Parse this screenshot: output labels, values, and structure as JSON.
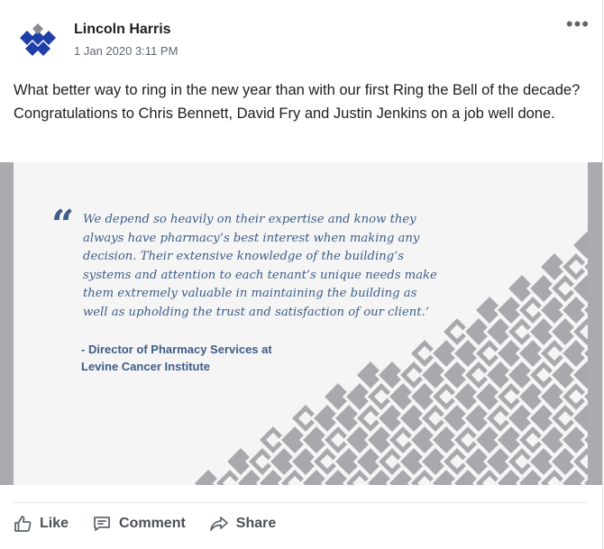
{
  "post": {
    "author": "Lincoln Harris",
    "timestamp": "1 Jan 2020 3:11 PM",
    "more_label": "•••",
    "text": "What better way to ring in the new year than with our first Ring the Bell of the decade? Congratulations to Chris Bennett, David Fry and Justin Jenkins on a job well done."
  },
  "image": {
    "quote_mark": "“",
    "quote": "We depend so heavily on their expertise and know they always have pharmacy’s best interest when making any decision. Their extensive knowledge of the building’s systems and attention to each tenant’s unique needs make them extremely valuable in maintaining the building as well as upholding the trust and satisfaction of our client.’",
    "attribution_line1": "- Director of Pharmacy Services at",
    "attribution_line2": "Levine Cancer Institute"
  },
  "actions": {
    "like": "Like",
    "comment": "Comment",
    "share": "Share"
  },
  "colors": {
    "brand_blue": "#1f3fa8",
    "quote_blue": "#3d5e87",
    "pattern_gray": "#a7a9ac"
  },
  "icons": [
    "company-logo-icon",
    "more-options-icon",
    "like-thumb-icon",
    "comment-icon",
    "share-arrow-icon"
  ]
}
